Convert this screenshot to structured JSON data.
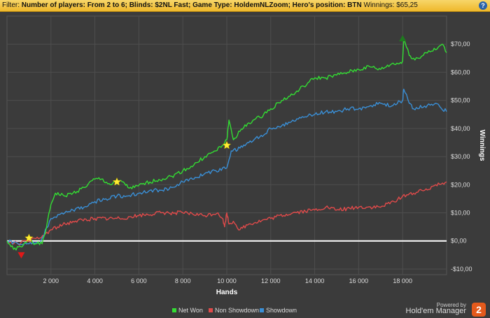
{
  "filter": {
    "prefix": "Filter: ",
    "bold_text": "Number of players: From 2 to 6; Blinds: $2NL Fast; Game Type: HoldemNLZoom; Hero's position: BTN",
    "winnings_label": " Winnings: $65,25",
    "help_icon": "?"
  },
  "branding": {
    "powered_by": "Powered by",
    "product": "Hold'em Manager",
    "logo_text": "2"
  },
  "colors": {
    "net_won": "#33dd33",
    "non_showdown": "#e04a4a",
    "showdown": "#3a8fd6",
    "background": "#3b3b3b",
    "zero_line": "#ffffff"
  },
  "chart_data": {
    "type": "line",
    "xlabel": "Hands",
    "ylabel": "Winnings",
    "xlim": [
      0,
      20000
    ],
    "ylim": [
      -12,
      80
    ],
    "x_ticks": [
      2000,
      4000,
      6000,
      8000,
      10000,
      12000,
      14000,
      16000,
      18000
    ],
    "x_tick_labels": [
      "2 000",
      "4 000",
      "6 000",
      "8 000",
      "10 000",
      "12 000",
      "14 000",
      "16 000",
      "18 000"
    ],
    "y_ticks": [
      -10,
      0,
      10,
      20,
      30,
      40,
      50,
      60,
      70
    ],
    "y_tick_labels": [
      "-$10,00",
      "$0,00",
      "$10,00",
      "$20,00",
      "$30,00",
      "$40,00",
      "$50,00",
      "$60,00",
      "$70,00"
    ],
    "grid": true,
    "legend_position": "bottom",
    "series": [
      {
        "name": "Net Won",
        "points": [
          [
            0,
            0
          ],
          [
            300,
            -3
          ],
          [
            700,
            -2
          ],
          [
            1000,
            1
          ],
          [
            1300,
            -1
          ],
          [
            1600,
            -1
          ],
          [
            1800,
            5
          ],
          [
            2000,
            13
          ],
          [
            2200,
            17
          ],
          [
            2600,
            16
          ],
          [
            3000,
            17
          ],
          [
            3500,
            19
          ],
          [
            4000,
            22
          ],
          [
            4300,
            22
          ],
          [
            4700,
            20
          ],
          [
            5000,
            21
          ],
          [
            5300,
            21
          ],
          [
            5500,
            19
          ],
          [
            5800,
            19
          ],
          [
            6500,
            21
          ],
          [
            7500,
            23
          ],
          [
            8000,
            25
          ],
          [
            8500,
            27
          ],
          [
            9000,
            30
          ],
          [
            9500,
            32
          ],
          [
            9800,
            34
          ],
          [
            10000,
            36
          ],
          [
            10100,
            43
          ],
          [
            10300,
            36
          ],
          [
            10600,
            39
          ],
          [
            11000,
            42
          ],
          [
            11500,
            44
          ],
          [
            12000,
            47
          ],
          [
            12500,
            50
          ],
          [
            13000,
            52
          ],
          [
            13500,
            55
          ],
          [
            14000,
            58
          ],
          [
            14500,
            58
          ],
          [
            15000,
            59
          ],
          [
            15500,
            60
          ],
          [
            16000,
            61
          ],
          [
            16500,
            62
          ],
          [
            17000,
            61
          ],
          [
            17500,
            63
          ],
          [
            17800,
            63
          ],
          [
            18000,
            64
          ],
          [
            18050,
            72
          ],
          [
            18300,
            66
          ],
          [
            18500,
            65
          ],
          [
            18800,
            65
          ],
          [
            19000,
            67
          ],
          [
            19500,
            68
          ],
          [
            19800,
            70
          ],
          [
            20000,
            67
          ]
        ]
      },
      {
        "name": "Non Showdown",
        "points": [
          [
            0,
            0
          ],
          [
            500,
            -1
          ],
          [
            1000,
            0
          ],
          [
            1500,
            1
          ],
          [
            2000,
            4
          ],
          [
            2300,
            5
          ],
          [
            3000,
            7
          ],
          [
            4000,
            8
          ],
          [
            5000,
            8
          ],
          [
            6000,
            9
          ],
          [
            7000,
            10
          ],
          [
            8000,
            10
          ],
          [
            9000,
            9
          ],
          [
            9600,
            10
          ],
          [
            9800,
            8
          ],
          [
            9900,
            5
          ],
          [
            10000,
            10
          ],
          [
            10100,
            6
          ],
          [
            10300,
            7
          ],
          [
            10600,
            4
          ],
          [
            11000,
            6
          ],
          [
            12000,
            8
          ],
          [
            13000,
            10
          ],
          [
            14000,
            11
          ],
          [
            14500,
            12
          ],
          [
            15000,
            11
          ],
          [
            16000,
            12
          ],
          [
            17000,
            12
          ],
          [
            17600,
            14
          ],
          [
            18000,
            16
          ],
          [
            18500,
            17
          ],
          [
            19000,
            18
          ],
          [
            19500,
            20
          ],
          [
            20000,
            21
          ]
        ]
      },
      {
        "name": "Showdown",
        "points": [
          [
            0,
            0
          ],
          [
            500,
            -1
          ],
          [
            1000,
            -1
          ],
          [
            1500,
            -1
          ],
          [
            2000,
            8
          ],
          [
            2500,
            10
          ],
          [
            3000,
            11
          ],
          [
            3500,
            12
          ],
          [
            4000,
            14
          ],
          [
            4500,
            15
          ],
          [
            5000,
            16
          ],
          [
            5500,
            16
          ],
          [
            6000,
            17
          ],
          [
            6500,
            18
          ],
          [
            7000,
            18
          ],
          [
            7500,
            19
          ],
          [
            8000,
            21
          ],
          [
            8500,
            22
          ],
          [
            9000,
            24
          ],
          [
            9500,
            25
          ],
          [
            10000,
            26
          ],
          [
            10200,
            32
          ],
          [
            10600,
            33
          ],
          [
            11000,
            35
          ],
          [
            11500,
            37
          ],
          [
            12000,
            40
          ],
          [
            12500,
            41
          ],
          [
            13000,
            43
          ],
          [
            13500,
            44
          ],
          [
            14000,
            45
          ],
          [
            14500,
            46
          ],
          [
            15000,
            46
          ],
          [
            15500,
            47
          ],
          [
            16000,
            47
          ],
          [
            16500,
            48
          ],
          [
            17000,
            49
          ],
          [
            17500,
            48
          ],
          [
            18000,
            50
          ],
          [
            18050,
            54
          ],
          [
            18300,
            49
          ],
          [
            18500,
            47
          ],
          [
            19000,
            48
          ],
          [
            19500,
            49
          ],
          [
            20000,
            46
          ]
        ]
      }
    ],
    "markers": [
      {
        "type": "star",
        "color": "#ffee33",
        "x": 1000,
        "y": 1
      },
      {
        "type": "star",
        "color": "#ffee33",
        "x": 5000,
        "y": 21
      },
      {
        "type": "star",
        "color": "#ffee33",
        "x": 10000,
        "y": 34
      },
      {
        "type": "triangle-down",
        "color": "#e01818",
        "x": 650,
        "y": -5
      },
      {
        "type": "triangle-up",
        "color": "#1f7a1f",
        "x": 18000,
        "y": 72
      }
    ]
  }
}
